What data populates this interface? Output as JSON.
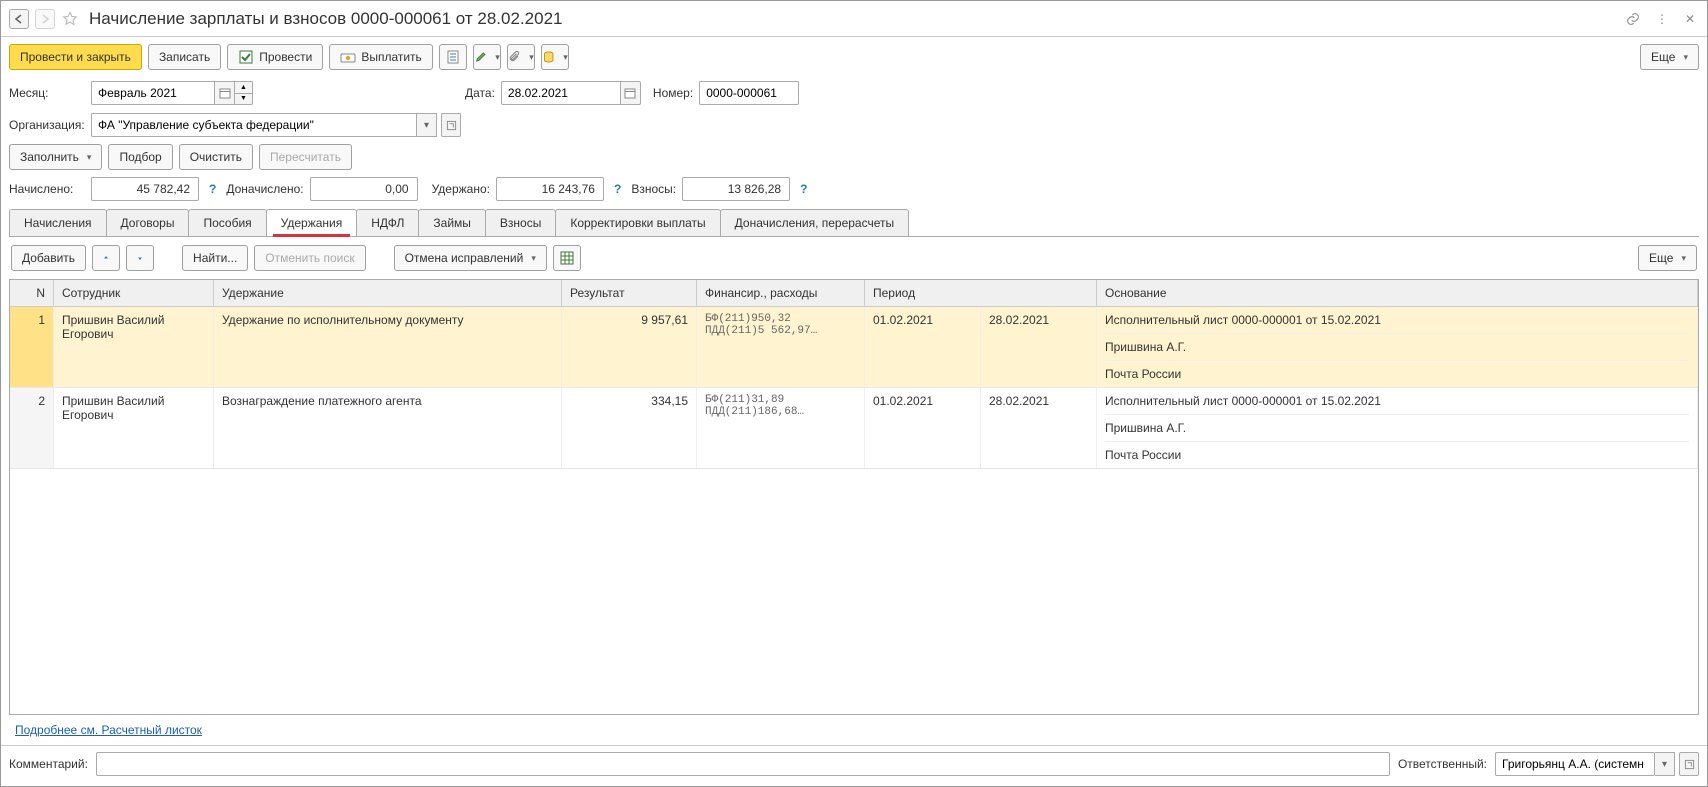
{
  "header": {
    "title": "Начисление зарплаты и взносов 0000-000061 от 28.02.2021"
  },
  "toolbar": {
    "post_close": "Провести и закрыть",
    "write": "Записать",
    "post": "Провести",
    "pay": "Выплатить",
    "more": "Еще"
  },
  "form": {
    "month_label": "Месяц:",
    "month_value": "Февраль 2021",
    "date_label": "Дата:",
    "date_value": "28.02.2021",
    "number_label": "Номер:",
    "number_value": "0000-000061",
    "org_label": "Организация:",
    "org_value": "ФА \"Управление субъекта федерации\""
  },
  "actions": {
    "fill": "Заполнить",
    "pick": "Подбор",
    "clear": "Очистить",
    "recalc": "Пересчитать"
  },
  "summary": {
    "accrued_label": "Начислено:",
    "accrued_value": "45 782,42",
    "extra_label": "Доначислено:",
    "extra_value": "0,00",
    "withheld_label": "Удержано:",
    "withheld_value": "16 243,76",
    "contrib_label": "Взносы:",
    "contrib_value": "13 826,28"
  },
  "tabs": [
    "Начисления",
    "Договоры",
    "Пособия",
    "Удержания",
    "НДФЛ",
    "Займы",
    "Взносы",
    "Корректировки выплаты",
    "Доначисления, перерасчеты"
  ],
  "active_tab": 3,
  "subtool": {
    "add": "Добавить",
    "find": "Найти...",
    "cancel_search": "Отменить поиск",
    "cancel_fix": "Отмена исправлений",
    "more": "Еще"
  },
  "grid": {
    "headers": {
      "n": "N",
      "emp": "Сотрудник",
      "hold": "Удержание",
      "res": "Результат",
      "fin": "Финансир., расходы",
      "per": "Период",
      "base": "Основание"
    },
    "rows": [
      {
        "n": "1",
        "emp": "Пришвин Василий Егорович",
        "hold": "Удержание по исполнительному документу",
        "res": "9 957,61",
        "fin": [
          "БФ(211)950,32",
          "ПДД(211)5 562,97…"
        ],
        "per1": "01.02.2021",
        "per2": "28.02.2021",
        "base": [
          "Исполнительный лист 0000-000001 от 15.02.2021",
          "Пришвина А.Г.",
          "Почта России"
        ],
        "selected": true
      },
      {
        "n": "2",
        "emp": "Пришвин Василий Егорович",
        "hold": "Вознаграждение платежного агента",
        "res": "334,15",
        "fin": [
          "БФ(211)31,89",
          "ПДД(211)186,68…"
        ],
        "per1": "01.02.2021",
        "per2": "28.02.2021",
        "base": [
          "Исполнительный лист 0000-000001 от 15.02.2021",
          "Пришвина А.Г.",
          "Почта России"
        ],
        "selected": false
      }
    ]
  },
  "detail_link": "Подробнее см. Расчетный листок",
  "footer": {
    "comment_label": "Комментарий:",
    "comment_value": "",
    "resp_label": "Ответственный:",
    "resp_value": "Григорьянц А.А. (системн"
  }
}
